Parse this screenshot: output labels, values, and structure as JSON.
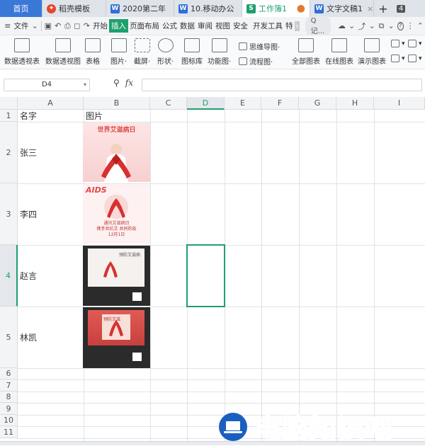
{
  "tabs": [
    {
      "label": "首页",
      "kind": "home"
    },
    {
      "label": "稻壳模板",
      "icon": "daoke-icon",
      "icon_color": "#e8452c"
    },
    {
      "label": "2020第二年",
      "icon": "word-icon",
      "icon_color": "#2f6fd6"
    },
    {
      "label": "10.移动办公",
      "icon": "word-icon",
      "icon_color": "#2f6fd6"
    },
    {
      "label": "工作簿1",
      "icon": "spreadsheet-icon",
      "icon_color": "#1ea06e",
      "active": true
    },
    {
      "label": "文字文稿1",
      "icon": "word-icon",
      "icon_color": "#2f6fd6"
    }
  ],
  "tab_count": "4",
  "menu": {
    "file": "文件",
    "items": [
      "开始",
      "插入",
      "页面布局",
      "公式",
      "数据",
      "审阅",
      "视图",
      "安全",
      "开发工具",
      "特色"
    ],
    "search": "Q 记..."
  },
  "ribbon": {
    "big": [
      {
        "label": "数据透视表"
      },
      {
        "label": "数据透视图"
      },
      {
        "label": "表格"
      },
      {
        "label": "图片·"
      },
      {
        "label": "截屏·"
      },
      {
        "label": "形状·"
      },
      {
        "label": "图标库"
      },
      {
        "label": "功能图·"
      },
      {
        "label": "全部图表"
      },
      {
        "label": "在线图表"
      },
      {
        "label": "演示图表"
      }
    ],
    "small": [
      {
        "label": "思维导图·"
      },
      {
        "label": "流程图·"
      }
    ]
  },
  "formula": {
    "name_box": "D4",
    "fx": "fx"
  },
  "columns": [
    "A",
    "B",
    "C",
    "D",
    "E",
    "F",
    "G",
    "H",
    "I"
  ],
  "rows": [
    "1",
    "2",
    "3",
    "4",
    "5",
    "6",
    "7",
    "8",
    "9",
    "10",
    "11"
  ],
  "cells": {
    "A1": "名字",
    "B1": "图片",
    "A2": "张三",
    "A3": "李四",
    "A4": "赵言",
    "A5": "林凯"
  },
  "pictures": {
    "p2": {
      "title": "世界艾滋病日"
    },
    "p3": {
      "title": "AIDS",
      "lines": [
        "通讯艾滋病日",
        "携手共抗艾 共同防疫",
        "12月1日"
      ]
    },
    "p4": {
      "title": "预防艾滋病"
    },
    "p5": {
      "title": "预防艾滋"
    }
  },
  "watermark": "电脑知识吧"
}
